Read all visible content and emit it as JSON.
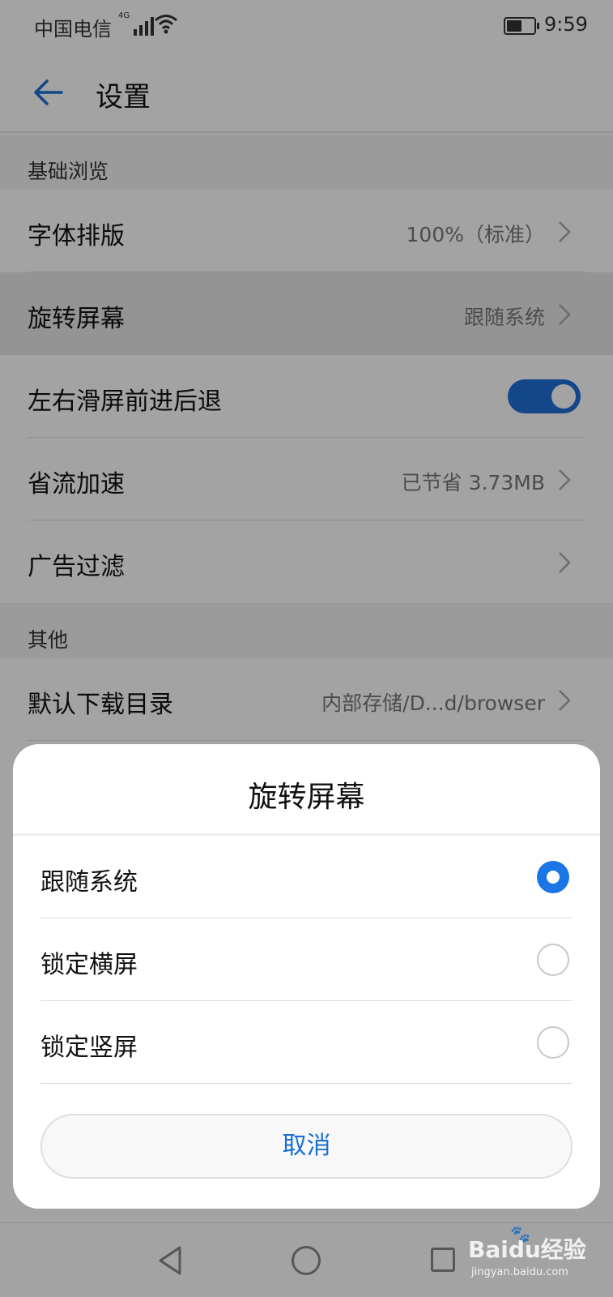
{
  "status_bar": {
    "carrier": "中国电信",
    "network": "4G",
    "time": "9:59"
  },
  "header": {
    "title": "设置"
  },
  "settings": {
    "section_basic": "基础浏览",
    "rows": [
      {
        "label": "字体排版",
        "value": "100%（标准）"
      },
      {
        "label": "旋转屏幕",
        "value": "跟随系统"
      },
      {
        "label": "左右滑屏前进后退",
        "toggle_on": true
      },
      {
        "label": "省流加速",
        "value": "已节省 3.73MB"
      },
      {
        "label": "广告过滤",
        "value": ""
      }
    ],
    "section_other": "其他",
    "other_rows": [
      {
        "label": "默认下载目录",
        "value": "内部存储/D...d/browser"
      }
    ]
  },
  "dialog": {
    "title": "旋转屏幕",
    "options": [
      {
        "label": "跟随系统",
        "selected": true
      },
      {
        "label": "锁定横屏",
        "selected": false
      },
      {
        "label": "锁定竖屏",
        "selected": false
      }
    ],
    "cancel_label": "取消"
  },
  "watermark": {
    "brand": "Baidu经验",
    "url": "jingyan.baidu.com"
  },
  "colors": {
    "accent": "#1a75e6",
    "toggle_on": "#1f6fd6",
    "cancel_text": "#1a6fd3"
  }
}
